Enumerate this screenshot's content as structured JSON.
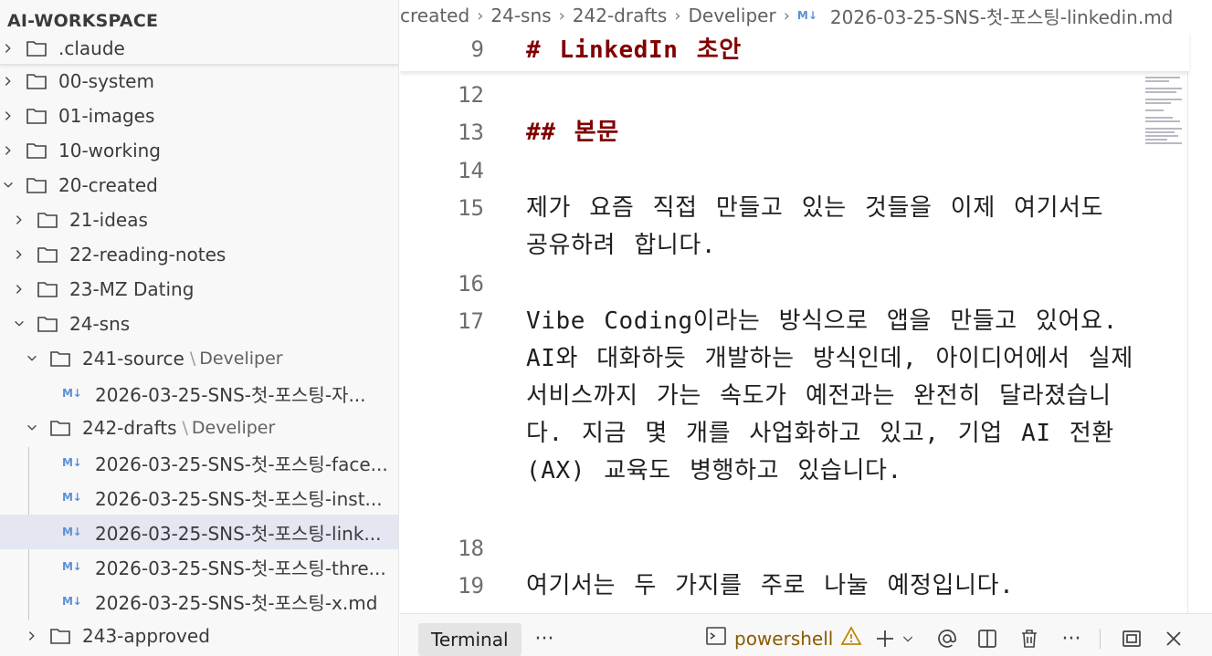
{
  "sidebar": {
    "title": "AI-WORKSPACE",
    "items": [
      {
        "label": ".claude",
        "kind": "folder",
        "state": "collapsed"
      },
      {
        "label": "00-system",
        "kind": "folder",
        "state": "collapsed"
      },
      {
        "label": "01-images",
        "kind": "folder",
        "state": "collapsed"
      },
      {
        "label": "10-working",
        "kind": "folder",
        "state": "collapsed"
      },
      {
        "label": "20-created",
        "kind": "folder",
        "state": "expanded"
      },
      {
        "label": "21-ideas",
        "kind": "folder",
        "state": "collapsed"
      },
      {
        "label": "22-reading-notes",
        "kind": "folder",
        "state": "collapsed"
      },
      {
        "label": "23-MZ Dating",
        "kind": "folder",
        "state": "collapsed"
      },
      {
        "label": "24-sns",
        "kind": "folder",
        "state": "expanded"
      },
      {
        "label": "241-source",
        "description": "Develiper",
        "kind": "folder",
        "state": "expanded"
      },
      {
        "label": "2026-03-25-SNS-첫-포스팅-자...",
        "kind": "md"
      },
      {
        "label": "242-drafts",
        "description": "Develiper",
        "kind": "folder",
        "state": "expanded"
      },
      {
        "label": "2026-03-25-SNS-첫-포스팅-face...",
        "kind": "md"
      },
      {
        "label": "2026-03-25-SNS-첫-포스팅-inst...",
        "kind": "md"
      },
      {
        "label": "2026-03-25-SNS-첫-포스팅-link...",
        "kind": "md",
        "selected": true
      },
      {
        "label": "2026-03-25-SNS-첫-포스팅-thre...",
        "kind": "md"
      },
      {
        "label": "2026-03-25-SNS-첫-포스팅-x.md",
        "kind": "md"
      },
      {
        "label": "243-approved",
        "kind": "folder",
        "state": "collapsed"
      }
    ],
    "md_badge": "M↓",
    "path_separator": "\\"
  },
  "breadcrumb": {
    "items": [
      "created",
      "24-sns",
      "242-drafts",
      "Develiper"
    ],
    "file": "2026-03-25-SNS-첫-포스팅-linkedin.md"
  },
  "editor": {
    "sticky": {
      "num": "9",
      "text": "# LinkedIn 초안"
    },
    "lines": [
      {
        "num": "12",
        "text": ""
      },
      {
        "num": "13",
        "text": "## 본문",
        "heading": true
      },
      {
        "num": "14",
        "text": ""
      },
      {
        "num": "15",
        "text": "제가 요즘 직접 만들고 있는 것들을 이제 여기서도 공유하려 합니다."
      },
      {
        "num": "16",
        "text": ""
      },
      {
        "num": "17",
        "text": "Vibe Coding이라는 방식으로 앱을 만들고 있어요. AI와 대화하듯 개발하는 방식인데, 아이디어에서 실제 서비스까지 가는 속도가 예전과는 완전히 달라졌습니다. 지금 몇 개를 사업화하고 있고, 기업 AI 전환(AX) 교육도 병행하고 있습니다."
      },
      {
        "num": "18",
        "text": ""
      },
      {
        "num": "19",
        "text": "여기서는 두 가지를 주로 나눌 예정입니다."
      }
    ]
  },
  "panel": {
    "tab": "Terminal",
    "more": "···",
    "shell": "powershell",
    "icons": [
      "terminal-icon",
      "warning-icon",
      "add-icon",
      "chevron-down-icon",
      "copilot-icon",
      "split-icon",
      "trash-icon",
      "more-icon",
      "maximize-icon",
      "close-icon"
    ]
  },
  "colors": {
    "heading": "#800000",
    "selected_row": "#e4e6f1",
    "md_badge": "#5d8fd6",
    "warning": "#bf8803"
  }
}
